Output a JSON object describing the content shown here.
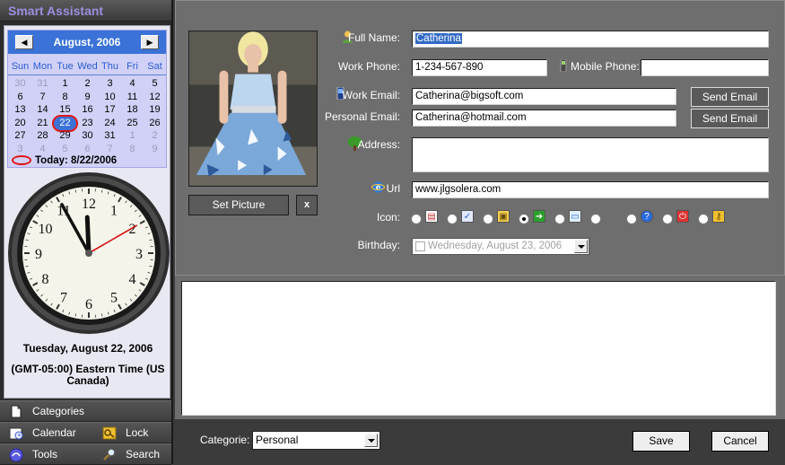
{
  "app": {
    "title": "Smart Assistant"
  },
  "calendar": {
    "month_label": "August, 2006",
    "prev_glyph": "◀",
    "next_glyph": "▶",
    "weekdays": [
      "Sun",
      "Mon",
      "Tue",
      "Wed",
      "Thu",
      "Fri",
      "Sat"
    ],
    "weeks": [
      [
        "30",
        "31",
        "1",
        "2",
        "3",
        "4",
        "5"
      ],
      [
        "6",
        "7",
        "8",
        "9",
        "10",
        "11",
        "12"
      ],
      [
        "13",
        "14",
        "15",
        "16",
        "17",
        "18",
        "19"
      ],
      [
        "20",
        "21",
        "22",
        "23",
        "24",
        "25",
        "26"
      ],
      [
        "27",
        "28",
        "29",
        "30",
        "31",
        "1",
        "2"
      ],
      [
        "3",
        "4",
        "5",
        "6",
        "7",
        "8",
        "9"
      ]
    ],
    "selected_day": "22",
    "today_label": "Today: 8/22/2006"
  },
  "clock": {
    "hour": 11,
    "minute": 55,
    "second": 10
  },
  "date_long": "Tuesday, August 22, 2006",
  "timezone": "(GMT-05:00) Eastern Time (US Canada)",
  "nav": {
    "categories": "Categories",
    "calendar": "Calendar",
    "lock": "Lock",
    "tools": "Tools",
    "search": "Search"
  },
  "photo": {
    "set_picture": "Set Picture",
    "clear": "x"
  },
  "form": {
    "full_name_label": "Full Name:",
    "full_name": "Catherina",
    "work_phone_label": "Work Phone:",
    "work_phone": "1-234-567-890",
    "mobile_phone_label": "Mobile Phone:",
    "mobile_phone": "",
    "work_email_label": "Work Email:",
    "work_email": "Catherina@bigsoft.com",
    "personal_email_label": "Personal Email:",
    "personal_email": "Catherina@hotmail.com",
    "send_email": "Send Email",
    "address_label": "Address:",
    "address": "",
    "url_label": "Url",
    "url": "www.jlgsolera.com",
    "icon_label": "Icon:",
    "icon_options": [
      "page-icon",
      "clipboard-icon",
      "calendar-icon",
      "exit-arrow-icon",
      "window-icon",
      "none",
      "help-icon",
      "stop-icon",
      "key-icon"
    ],
    "icon_selected_index": 3,
    "birthday_label": "Birthday:",
    "birthday": "Wednesday,   August   23, 2006"
  },
  "bottom": {
    "categorie_label": "Categorie:",
    "categorie_value": "Personal",
    "save": "Save",
    "cancel": "Cancel"
  },
  "colors": {
    "calendar_header": "#3a72d8",
    "calendar_bg": "#d1d1f7",
    "panel_gray": "#6e6e6e",
    "sidebar_dark": "#2b2b2b",
    "highlight_red": "#e01616"
  }
}
